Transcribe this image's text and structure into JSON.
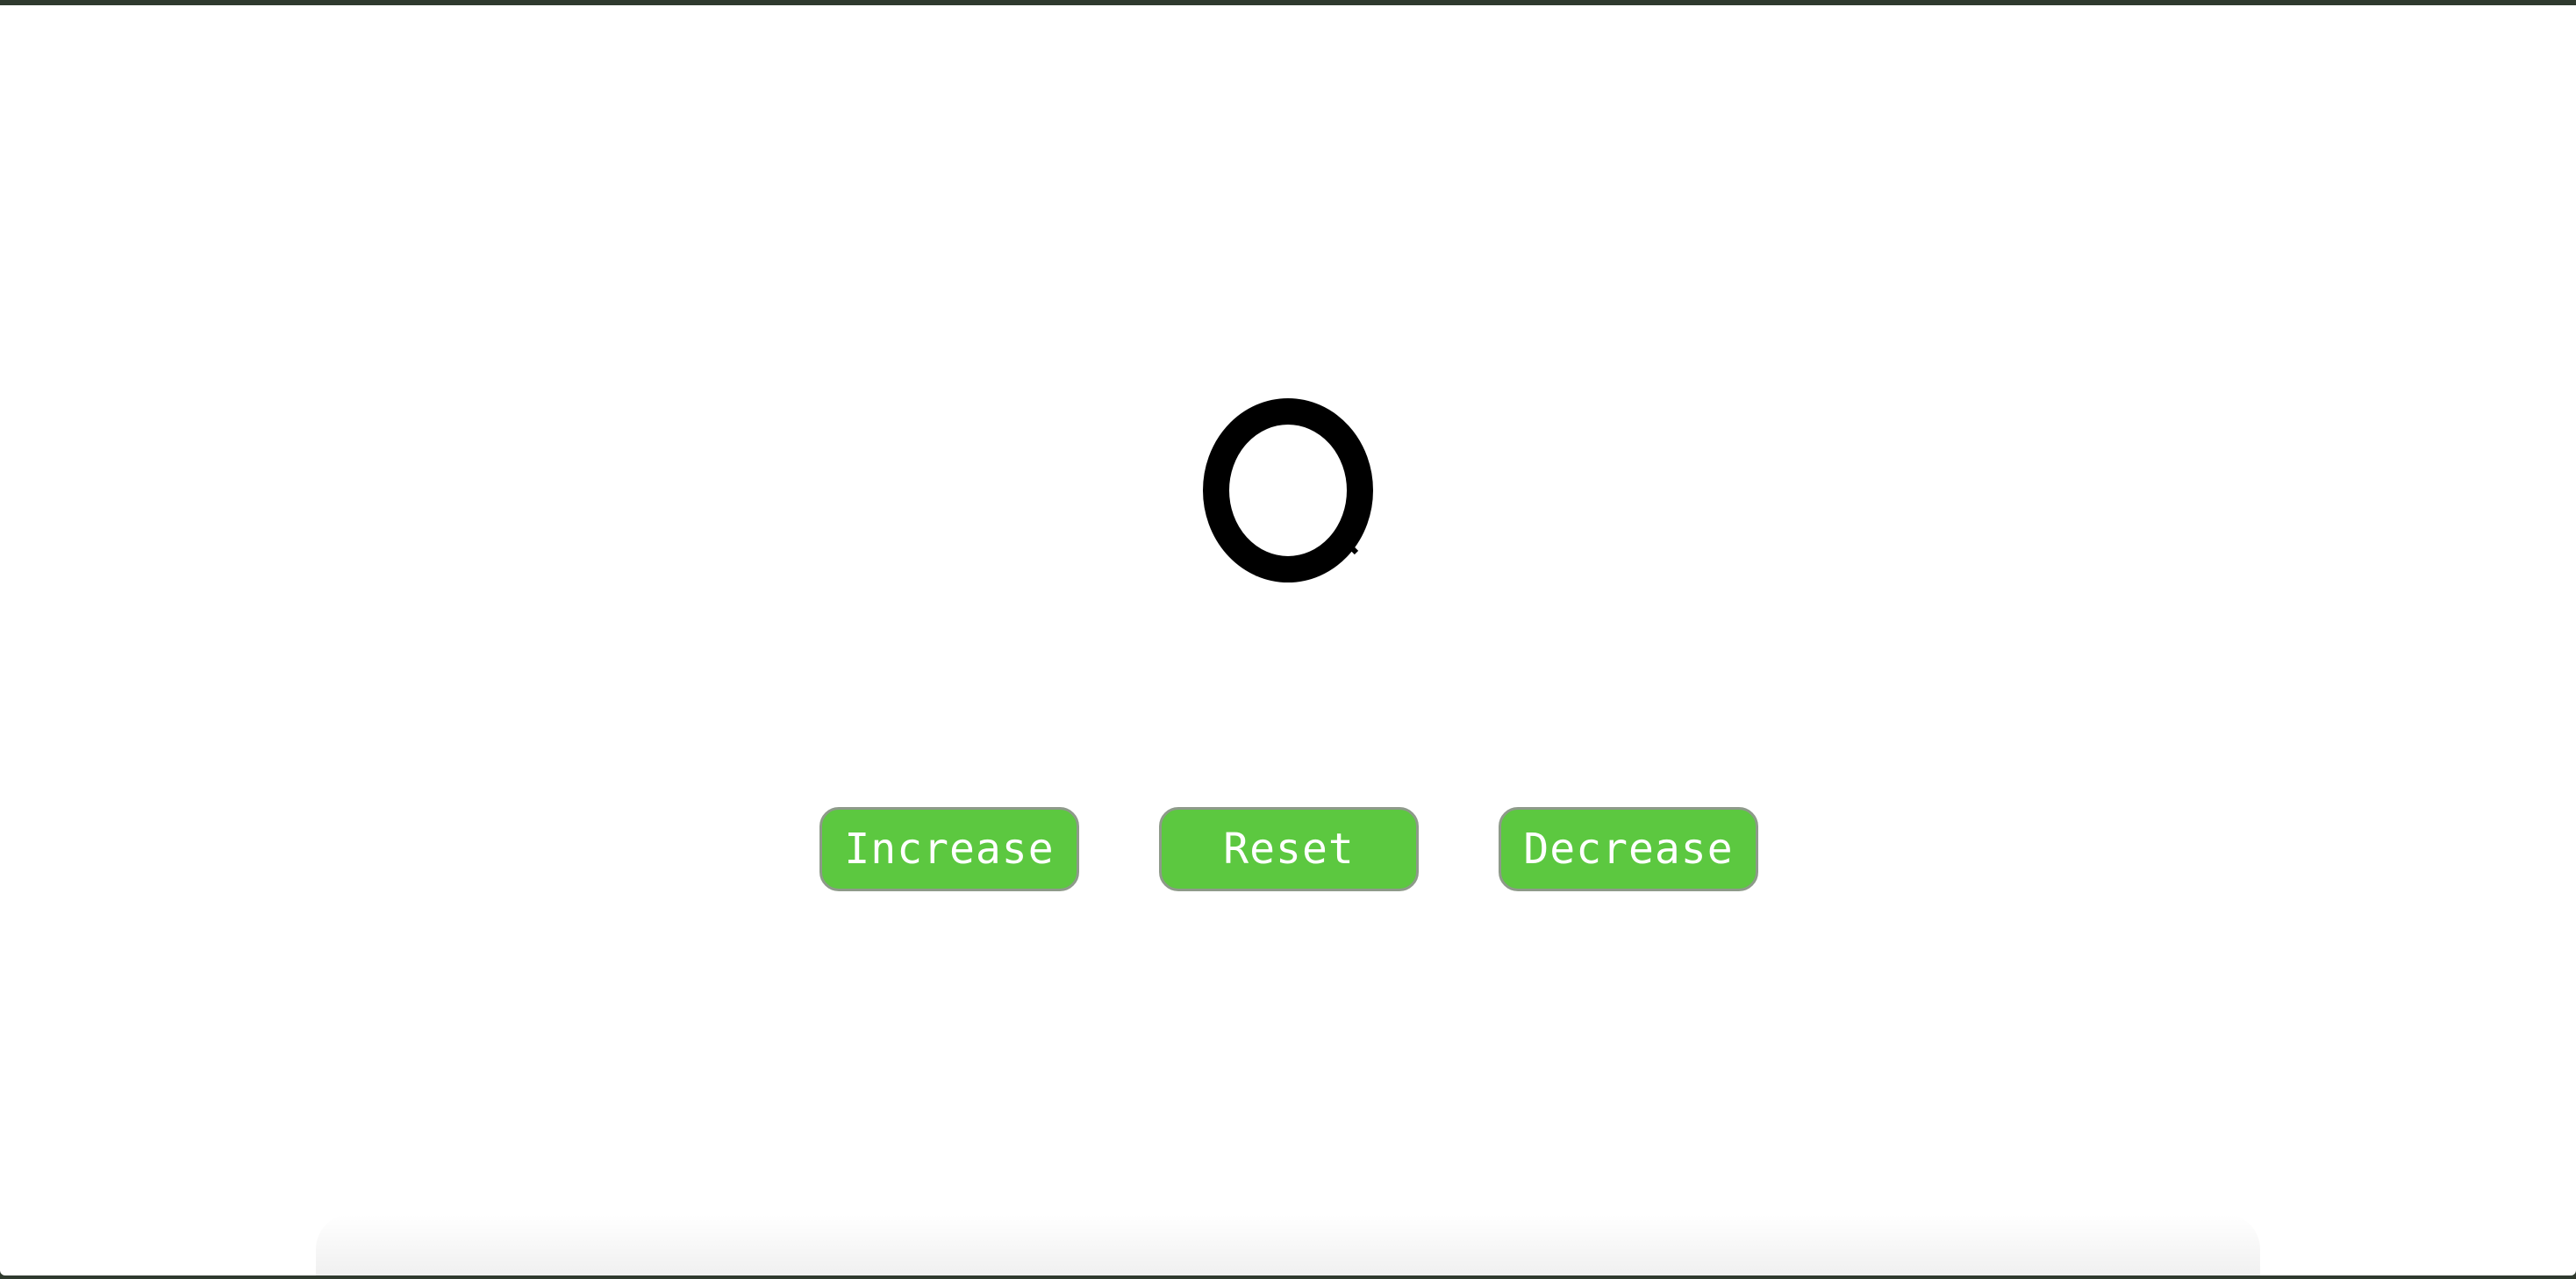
{
  "counter": {
    "value": "0"
  },
  "buttons": {
    "increase_label": "Increase",
    "reset_label": "Reset",
    "decrease_label": "Decrease"
  },
  "colors": {
    "button_bg": "#5cc840",
    "button_text": "#ffffff",
    "digit": "#000000",
    "page_bg": "#ffffff"
  }
}
